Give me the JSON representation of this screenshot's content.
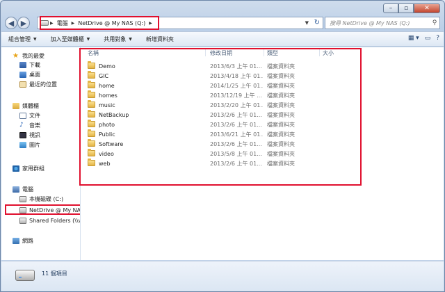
{
  "address": {
    "crumbs": [
      "電腦",
      "NetDrive @ My NAS (Q:)"
    ],
    "search_placeholder": "搜尋 NetDrive @ My NAS (Q:)"
  },
  "toolbar": {
    "organize": "組合管理",
    "include_library": "加入至媒體櫃",
    "share_with": "共用對象",
    "new_folder": "新增資料夾"
  },
  "nav": {
    "favorites": "我的最愛",
    "downloads": "下載",
    "desktop": "桌面",
    "recent": "最近的位置",
    "libraries": "媒體櫃",
    "documents": "文件",
    "music": "音樂",
    "videos": "視訊",
    "pictures": "圖片",
    "homegroup": "家用群組",
    "computer": "電腦",
    "local_disk": "本機磁碟 (C:)",
    "netdrive": "NetDrive @ My NAS",
    "shared_folders": "Shared Folders (\\\\v",
    "network": "網路"
  },
  "columns": {
    "name": "名稱",
    "date": "修改日期",
    "type": "類型",
    "size": "大小"
  },
  "files": [
    {
      "name": "Demo",
      "date": "2013/6/3 上午 01...",
      "type": "檔案資料夾"
    },
    {
      "name": "GIC",
      "date": "2013/4/18 上午 01...",
      "type": "檔案資料夾"
    },
    {
      "name": "home",
      "date": "2014/1/25 上午 01...",
      "type": "檔案資料夾"
    },
    {
      "name": "homes",
      "date": "2013/12/19 上午 ...",
      "type": "檔案資料夾"
    },
    {
      "name": "music",
      "date": "2013/2/20 上午 01...",
      "type": "檔案資料夾"
    },
    {
      "name": "NetBackup",
      "date": "2013/2/6 上午 01...",
      "type": "檔案資料夾"
    },
    {
      "name": "photo",
      "date": "2013/2/6 上午 01...",
      "type": "檔案資料夾"
    },
    {
      "name": "Public",
      "date": "2013/6/21 上午 01...",
      "type": "檔案資料夾"
    },
    {
      "name": "Software",
      "date": "2013/2/6 上午 01...",
      "type": "檔案資料夾"
    },
    {
      "name": "video",
      "date": "2013/5/8 上午 01...",
      "type": "檔案資料夾"
    },
    {
      "name": "web",
      "date": "2013/2/6 上午 01...",
      "type": "檔案資料夾"
    }
  ],
  "status": {
    "count": "11 個項目"
  },
  "colors": {
    "highlight": "#e0102e",
    "folder": "#e3b446"
  }
}
